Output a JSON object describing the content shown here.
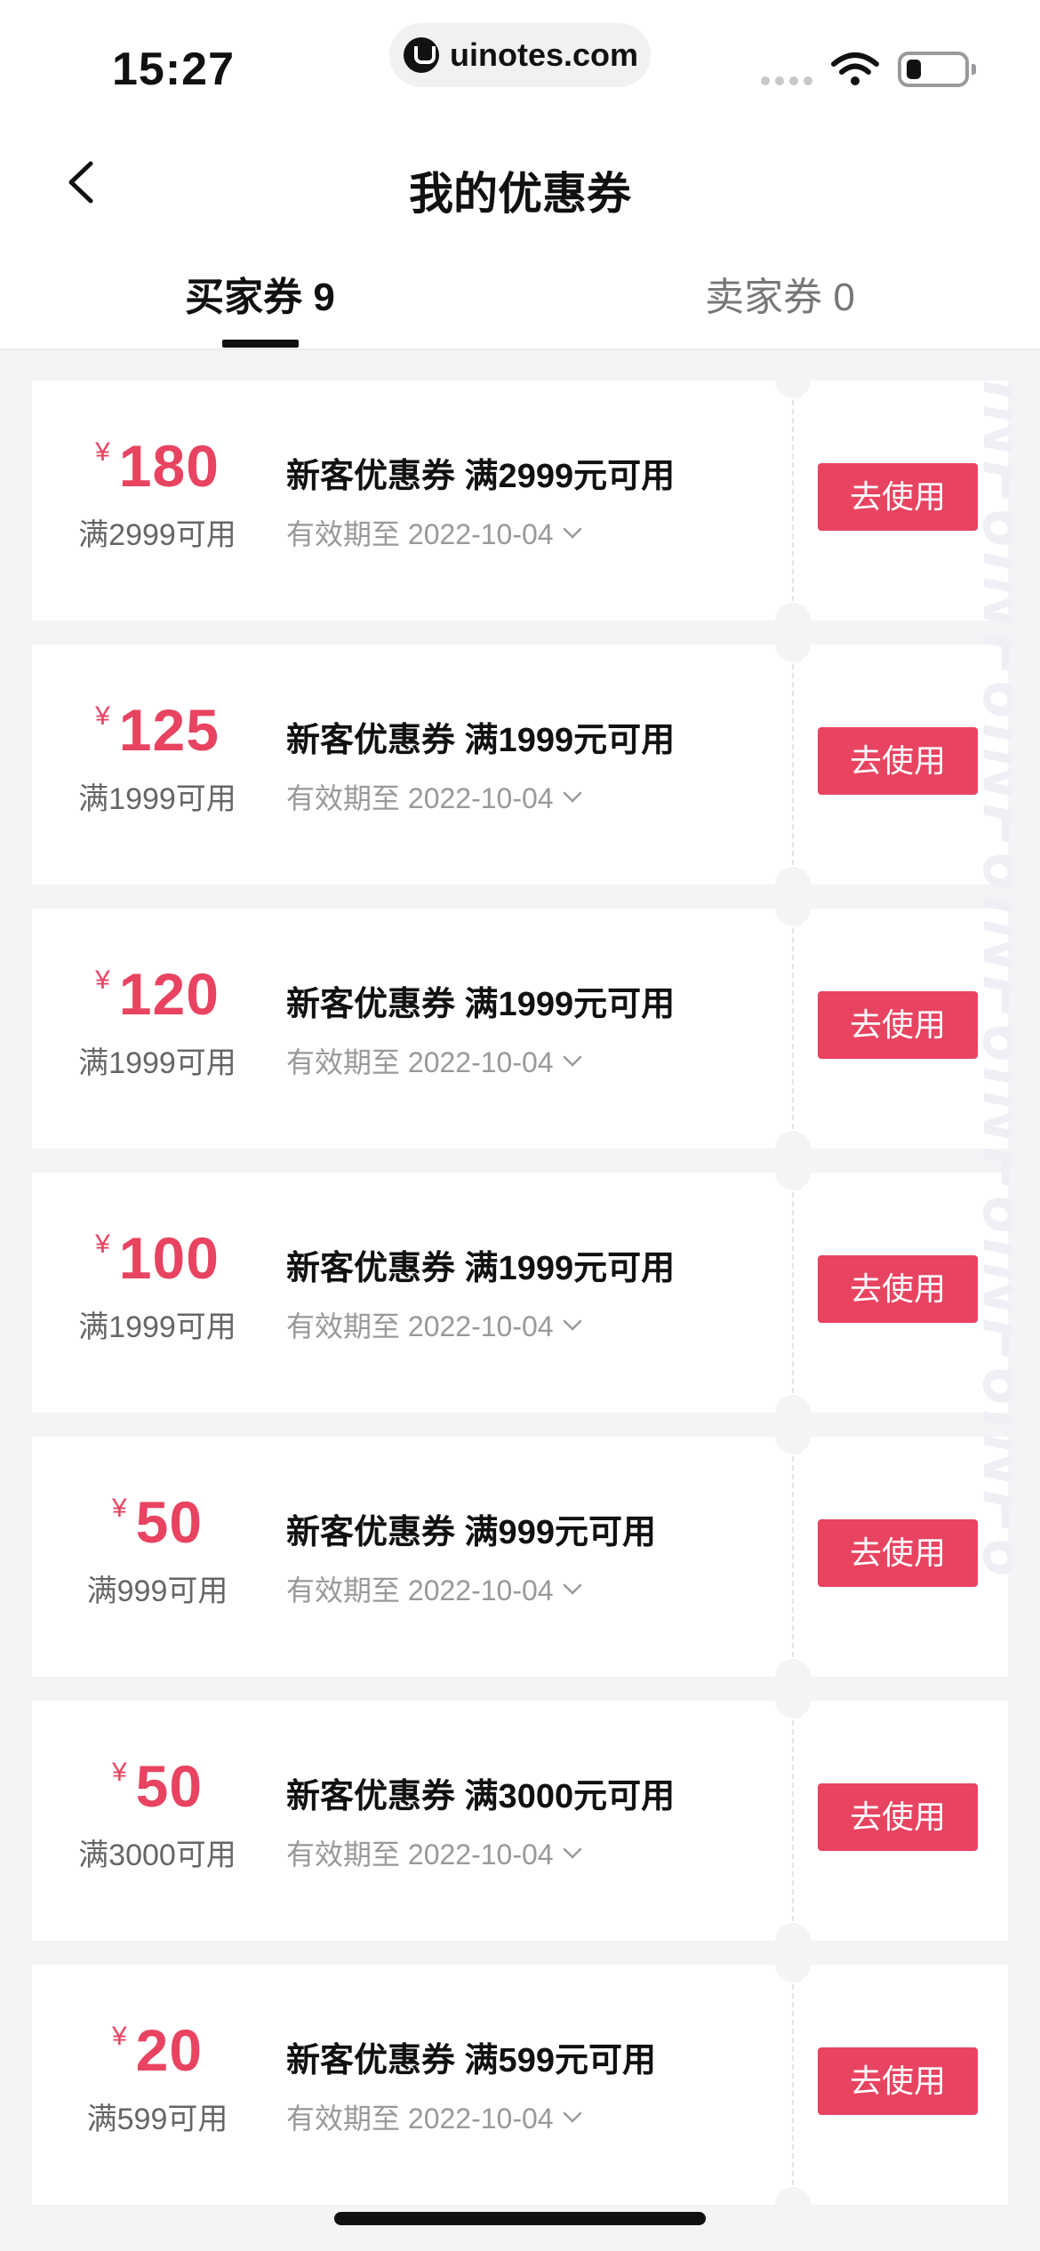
{
  "status_bar": {
    "time": "15:27",
    "url": "uinotes.com"
  },
  "header": {
    "title": "我的优惠券"
  },
  "tabs": [
    {
      "label": "买家券 9",
      "active": true
    },
    {
      "label": "卖家券 0",
      "active": false
    }
  ],
  "coupons": [
    {
      "currency": "¥",
      "amount": "180",
      "threshold": "满2999可用",
      "title": "新客优惠券 满2999元可用",
      "expiry": "有效期至 2022-10-04",
      "button": "去使用"
    },
    {
      "currency": "¥",
      "amount": "125",
      "threshold": "满1999可用",
      "title": "新客优惠券 满1999元可用",
      "expiry": "有效期至 2022-10-04",
      "button": "去使用"
    },
    {
      "currency": "¥",
      "amount": "120",
      "threshold": "满1999可用",
      "title": "新客优惠券 满1999元可用",
      "expiry": "有效期至 2022-10-04",
      "button": "去使用"
    },
    {
      "currency": "¥",
      "amount": "100",
      "threshold": "满1999可用",
      "title": "新客优惠券 满1999元可用",
      "expiry": "有效期至 2022-10-04",
      "button": "去使用"
    },
    {
      "currency": "¥",
      "amount": "50",
      "threshold": "满999可用",
      "title": "新客优惠券 满999元可用",
      "expiry": "有效期至 2022-10-04",
      "button": "去使用"
    },
    {
      "currency": "¥",
      "amount": "50",
      "threshold": "满3000可用",
      "title": "新客优惠券 满3000元可用",
      "expiry": "有效期至 2022-10-04",
      "button": "去使用"
    },
    {
      "currency": "¥",
      "amount": "20",
      "threshold": "满599可用",
      "title": "新客优惠券 满599元可用",
      "expiry": "有效期至 2022-10-04",
      "button": "去使用"
    }
  ],
  "watermark": "INF6INF6INF6INF6INF6INF6INF6",
  "colors": {
    "accent": "#e84360",
    "background": "#f4f4f7"
  },
  "icons": {
    "back": "back-chevron-icon",
    "expand": "chevron-down-icon"
  }
}
